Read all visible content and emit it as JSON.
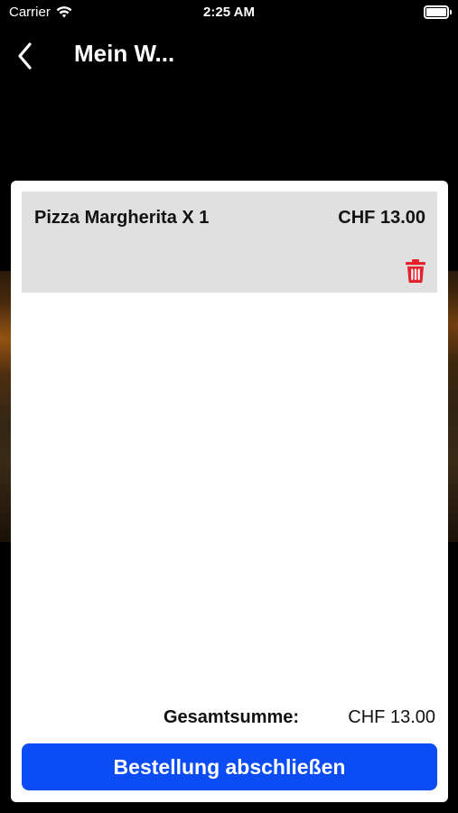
{
  "status_bar": {
    "carrier": "Carrier",
    "time": "2:25 AM",
    "wifi_icon": "wifi-icon",
    "battery_icon": "battery-icon"
  },
  "nav": {
    "back_icon": "chevron-left-icon",
    "title": "Mein W..."
  },
  "cart": {
    "items": [
      {
        "label": "Pizza Margherita X 1",
        "price": "CHF 13.00",
        "delete_icon": "trash-icon"
      }
    ],
    "total_label": "Gesamtsumme:",
    "total_value": "CHF 13.00",
    "checkout_label": "Bestellung abschließen"
  },
  "colors": {
    "primary": "#0b4cf5",
    "delete": "#e5202b",
    "item_background": "#e0e0e0"
  }
}
